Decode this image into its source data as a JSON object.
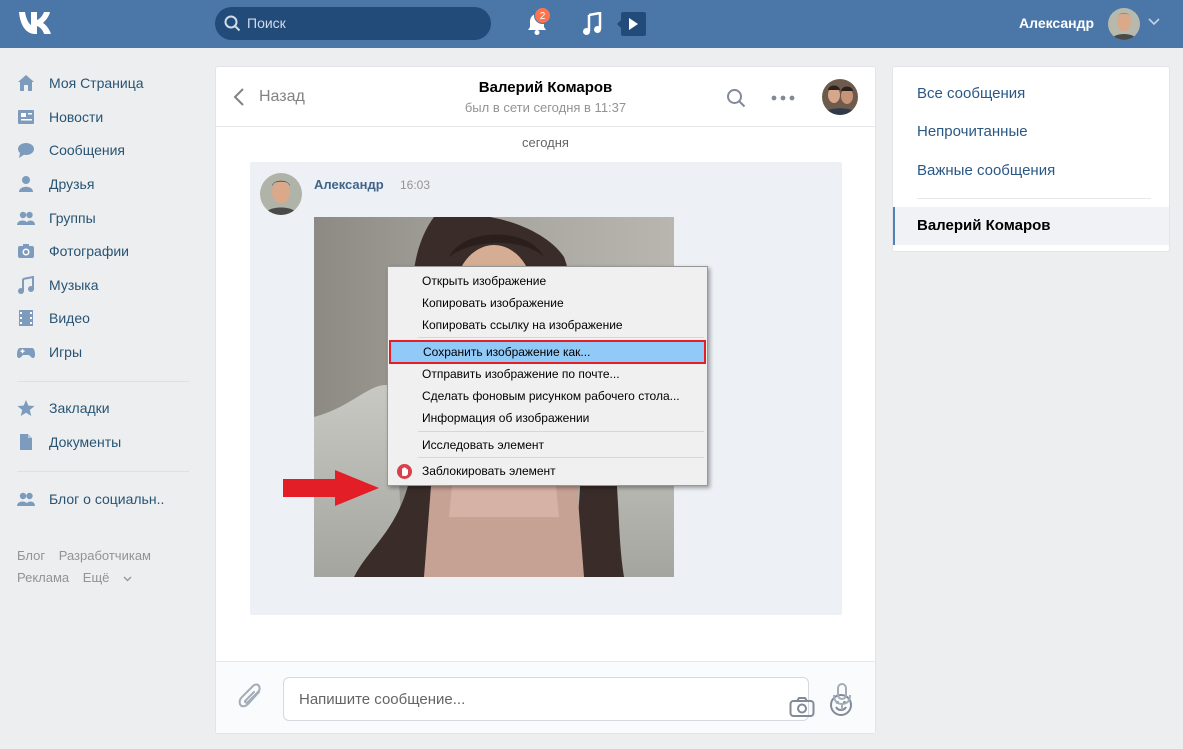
{
  "header": {
    "search_placeholder": "Поиск",
    "notifications_count": "2",
    "user_name": "Александр"
  },
  "nav": {
    "items": [
      {
        "label": "Моя Страница",
        "icon": "home-icon"
      },
      {
        "label": "Новости",
        "icon": "news-icon"
      },
      {
        "label": "Сообщения",
        "icon": "messages-icon"
      },
      {
        "label": "Друзья",
        "icon": "friends-icon"
      },
      {
        "label": "Группы",
        "icon": "groups-icon"
      },
      {
        "label": "Фотографии",
        "icon": "camera-icon"
      },
      {
        "label": "Музыка",
        "icon": "music-icon"
      },
      {
        "label": "Видео",
        "icon": "video-icon"
      },
      {
        "label": "Игры",
        "icon": "games-icon"
      }
    ],
    "items2": [
      {
        "label": "Закладки",
        "icon": "star-icon"
      },
      {
        "label": "Документы",
        "icon": "document-icon"
      }
    ],
    "items3": [
      {
        "label": "Блог о социальн..",
        "icon": "community-icon"
      }
    ],
    "footer": {
      "blog": "Блог",
      "developers": "Разработчикам",
      "ads": "Реклама",
      "more": "Ещё"
    }
  },
  "chat": {
    "back_label": "Назад",
    "peer_name": "Валерий Комаров",
    "peer_status": "был в сети сегодня в 11:37",
    "day_label": "сегодня",
    "message": {
      "author": "Александр",
      "time": "16:03"
    },
    "compose_placeholder": "Напишите сообщение..."
  },
  "context_menu": {
    "items": [
      "Открыть изображение",
      "Копировать изображение",
      "Копировать ссылку на изображение",
      "Сохранить изображение как...",
      "Отправить изображение по почте...",
      "Сделать фоновым рисунком рабочего стола...",
      "Информация об изображении",
      "Исследовать элемент",
      "Заблокировать элемент"
    ],
    "highlighted_index": 3
  },
  "right_panel": {
    "all": "Все сообщения",
    "unread": "Непрочитанные",
    "important": "Важные сообщения",
    "active_conversation": "Валерий Комаров"
  },
  "colors": {
    "header_bg": "#4a76a8",
    "page_bg": "#edeef0",
    "link": "#2a5885",
    "highlight": "#91c9f7",
    "highlight_border": "#e41e26",
    "arrow": "#e41e26"
  }
}
